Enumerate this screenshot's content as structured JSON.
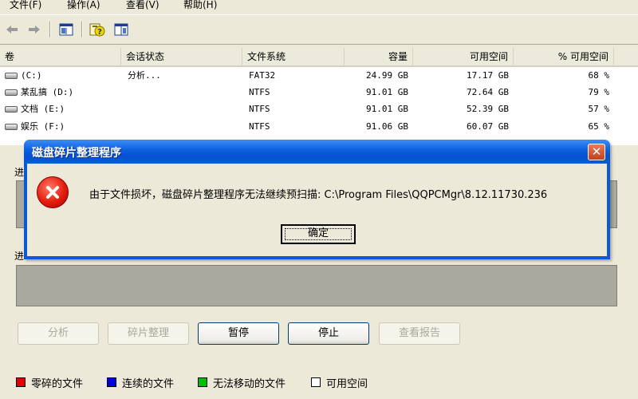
{
  "menu": [
    "文件(F)",
    "操作(A)",
    "查看(V)",
    "帮助(H)"
  ],
  "toolbar": {
    "back_icon": "arrow-left-icon",
    "forward_icon": "arrow-right-icon",
    "panel_icon": "console-tree-icon",
    "help_icon": "help-icon",
    "properties_icon": "properties-icon"
  },
  "volumes": {
    "columns": [
      "卷",
      "会话状态",
      "文件系统",
      "容量",
      "可用空间",
      "% 可用空间"
    ],
    "rows": [
      {
        "volume": "(C:)",
        "status": "分析...",
        "fs": "FAT32",
        "capacity": "24.99 GB",
        "free": "17.17 GB",
        "pct": "68 %"
      },
      {
        "volume": "某乱搞 (D:)",
        "status": "",
        "fs": "NTFS",
        "capacity": "91.01 GB",
        "free": "72.64 GB",
        "pct": "79 %"
      },
      {
        "volume": "文档 (E:)",
        "status": "",
        "fs": "NTFS",
        "capacity": "91.01 GB",
        "free": "52.39 GB",
        "pct": "57 %"
      },
      {
        "volume": "娱乐 (F:)",
        "status": "",
        "fs": "NTFS",
        "capacity": "91.06 GB",
        "free": "60.07 GB",
        "pct": "65 %"
      }
    ]
  },
  "sections": {
    "before_label": "进",
    "after_label": "进"
  },
  "buttons": {
    "analyze": "分析",
    "defrag": "碎片整理",
    "pause": "暂停",
    "stop": "停止",
    "report": "查看报告"
  },
  "legend": [
    {
      "label": "零碎的文件",
      "color": "#e00000"
    },
    {
      "label": "连续的文件",
      "color": "#0000e0"
    },
    {
      "label": "无法移动的文件",
      "color": "#00c000"
    },
    {
      "label": "可用空间",
      "color": "#ffffff"
    }
  ],
  "dialog": {
    "title": "磁盘碎片整理程序",
    "close_glyph": "✕",
    "icon": "error-icon",
    "message": "由于文件损坏，磁盘碎片整理程序无法继续预扫描: C:\\Program Files\\QQPCMgr\\8.12.11730.236",
    "ok": "确定"
  }
}
